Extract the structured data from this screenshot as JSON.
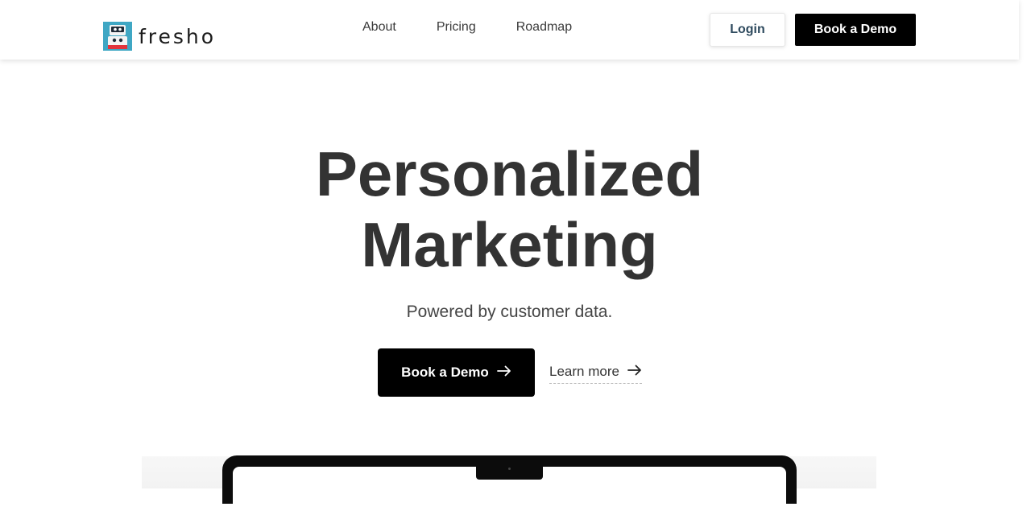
{
  "brand": {
    "name": "fresho"
  },
  "nav": {
    "items": [
      "About",
      "Pricing",
      "Roadmap"
    ]
  },
  "header": {
    "login_label": "Login",
    "demo_label": "Book a Demo"
  },
  "hero": {
    "title_line1": "Personalized",
    "title_line2": "Marketing",
    "subtitle": "Powered by customer data.",
    "cta_primary": "Book a Demo",
    "cta_secondary": "Learn more"
  },
  "icons": {
    "logo": "robot-logo-icon",
    "cta_arrow": "arrow-right-icon"
  },
  "colors": {
    "primary_button": "#000000",
    "login_text": "#2e4a5e",
    "heading": "#333333",
    "logo_teal": "#3fa7c4",
    "logo_red": "#e2343c"
  }
}
